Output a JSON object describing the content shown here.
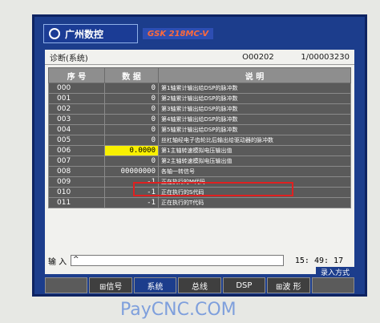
{
  "brand": {
    "logo_text": "广州数控",
    "model_text": "GSK 218MC-V"
  },
  "panel": {
    "title": "诊断(系统)",
    "code": "O00202",
    "page": "1/00003230"
  },
  "table": {
    "headers": [
      "序 号",
      "数 据",
      "说 明"
    ],
    "rows": [
      {
        "num": "000",
        "val": "0",
        "desc": "第1轴累计输出给DSP的脉冲数"
      },
      {
        "num": "001",
        "val": "0",
        "desc": "第2轴累计输出给DSP的脉冲数"
      },
      {
        "num": "002",
        "val": "0",
        "desc": "第3轴累计输出给DSP的脉冲数"
      },
      {
        "num": "003",
        "val": "0",
        "desc": "第4轴累计输出给DSP的脉冲数"
      },
      {
        "num": "004",
        "val": "0",
        "desc": "第5轴累计输出给DSP的脉冲数"
      },
      {
        "num": "005",
        "val": "0",
        "desc": "丝杠轴经电子齿轮比后输出给驱动器的脉冲数"
      },
      {
        "num": "006",
        "val": "0.0000",
        "desc": "第1主轴转速模拟电压输出值"
      },
      {
        "num": "007",
        "val": "0",
        "desc": "第2主轴转速模拟电压输出值"
      },
      {
        "num": "008",
        "val": "00000000",
        "desc": "各轴一转信号"
      },
      {
        "num": "009",
        "val": "-1",
        "desc": "正在执行的M代码"
      },
      {
        "num": "010",
        "val": "-1",
        "desc": "正在执行的S代码"
      },
      {
        "num": "011",
        "val": "-1",
        "desc": "正在执行的T代码"
      }
    ]
  },
  "input": {
    "label": "输 入",
    "value": "^",
    "time": "15: 49: 17",
    "mode": "录入方式"
  },
  "softkeys": [
    "",
    "⊞信号",
    "系统",
    "总线",
    "DSP",
    "⊞波 形",
    ""
  ],
  "watermark": "PayCNC.COM"
}
